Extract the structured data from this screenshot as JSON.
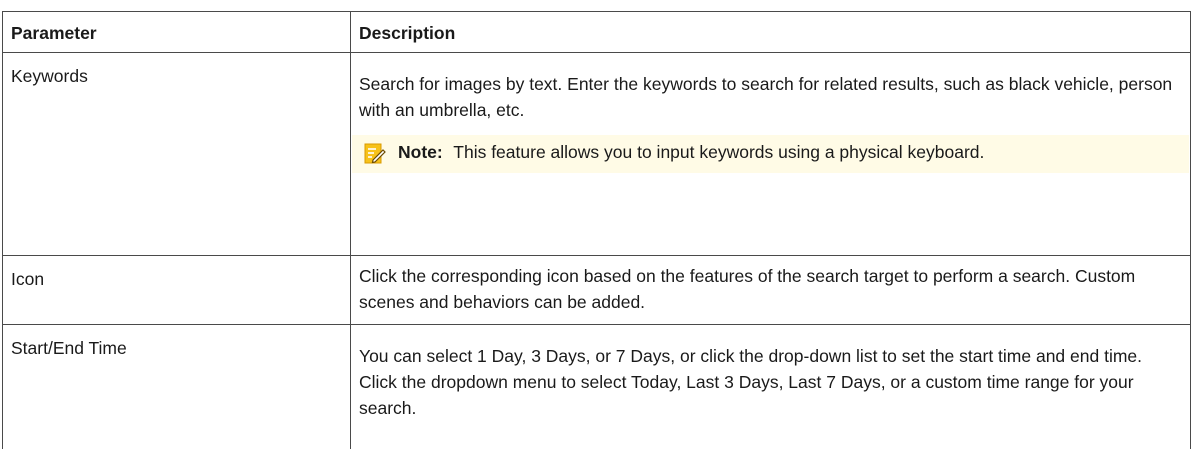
{
  "table": {
    "headers": {
      "parameter": "Parameter",
      "description": "Description"
    },
    "rows": [
      {
        "parameter": "Keywords",
        "description": "Search for images by text. Enter the keywords to search for related results, such as black vehicle, person with an umbrella, etc.",
        "note": {
          "label": "Note:",
          "text": "This feature allows you to input keywords using a physical keyboard."
        }
      },
      {
        "parameter": "Icon",
        "description": "Click the corresponding icon based on the features of the search target to perform a search. Custom scenes and behaviors can be added."
      },
      {
        "parameter": "Start/End Time",
        "description": "You can select 1 Day, 3 Days, or 7 Days, or click the drop-down list to set the start time and end time. Click the dropdown menu to select Today, Last 3 Days, Last 7 Days, or a custom time range for your search."
      }
    ]
  },
  "colors": {
    "note_background": "#fffbe6",
    "note_icon": "#f0b400",
    "border": "#4a4a4a"
  },
  "icons": {
    "note": "note-pencil-icon"
  }
}
